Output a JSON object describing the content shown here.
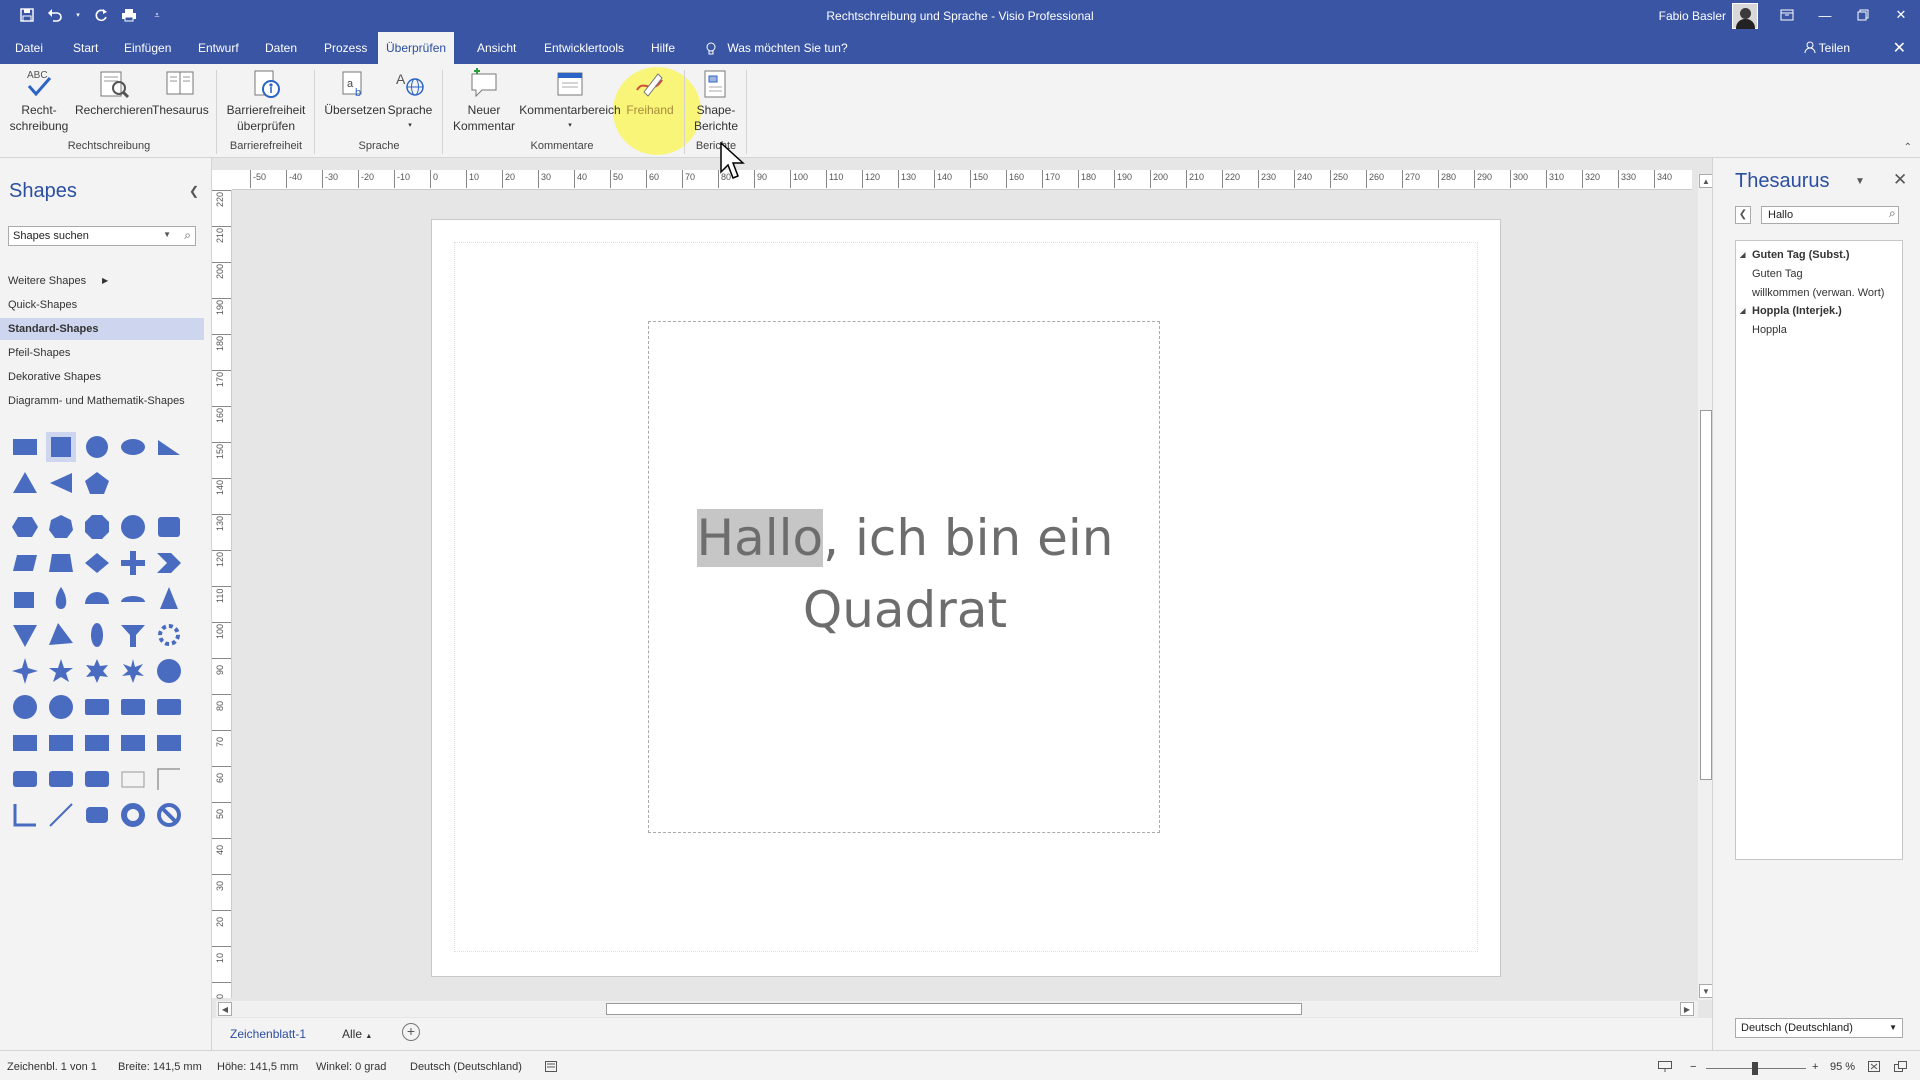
{
  "window": {
    "title": "Rechtschreibung und Sprache - Visio Professional",
    "user": "Fabio Basler",
    "qat": [
      "save-icon",
      "undo-icon",
      "redo-icon",
      "print-icon",
      "customize-icon"
    ]
  },
  "tabs": [
    "Datei",
    "Start",
    "Einfügen",
    "Entwurf",
    "Daten",
    "Prozess",
    "Überprüfen",
    "Ansicht",
    "Entwicklertools",
    "Hilfe"
  ],
  "active_tab": "Überprüfen",
  "tell_me": "Was möchten Sie tun?",
  "share": "Teilen",
  "ribbon": {
    "buttons": {
      "spelling": "Recht-\nschreibung",
      "research": "Recherchieren",
      "thesaurus": "Thesaurus",
      "accessibility": "Barrierefreiheit\nüberprüfen",
      "translate": "Übersetzen",
      "language": "Sprache",
      "new_comment": "Neuer\nKommentar",
      "comment_pane": "Kommentarbereich",
      "freehand": "Freihand",
      "shape_reports": "Shape-\nBerichte"
    },
    "groups": {
      "proofing": "Rechtschreibung",
      "accessibility": "Barrierefreiheit",
      "language": "Sprache",
      "comments": "Kommentare",
      "reports": "Berichte"
    }
  },
  "shapes_pane": {
    "title": "Shapes",
    "search_placeholder": "Shapes suchen",
    "stencils": [
      {
        "label": "Weitere Shapes",
        "selected": false
      },
      {
        "label": "Quick-Shapes",
        "selected": false
      },
      {
        "label": "Standard-Shapes",
        "selected": true
      },
      {
        "label": "Pfeil-Shapes",
        "selected": false
      },
      {
        "label": "Dekorative Shapes",
        "selected": false
      },
      {
        "label": "Diagramm- und Mathematik-Shapes",
        "selected": false
      }
    ]
  },
  "ruler": {
    "h_labels": [
      "-50",
      "-40",
      "-30",
      "-20",
      "-10",
      "0",
      "10",
      "20",
      "30",
      "40",
      "50",
      "60",
      "70",
      "80",
      "90",
      "100",
      "110",
      "120",
      "130",
      "140",
      "150",
      "160",
      "170",
      "180",
      "190",
      "200",
      "210",
      "220",
      "230",
      "240",
      "250",
      "260",
      "270",
      "280",
      "290",
      "300",
      "310",
      "320",
      "330",
      "340"
    ],
    "v_labels": [
      "220",
      "210",
      "200",
      "190",
      "180",
      "170",
      "160",
      "150",
      "140",
      "130",
      "120",
      "110",
      "100",
      "90",
      "80",
      "70",
      "60",
      "50",
      "40",
      "30",
      "20",
      "10",
      "0"
    ]
  },
  "canvas": {
    "highlight_word": "Hallo",
    "text_rest": ", ich bin ein",
    "text_line2": "Quadrat"
  },
  "sheets": {
    "tab": "Zeichenblatt-1",
    "all": "Alle"
  },
  "thesaurus": {
    "title": "Thesaurus",
    "search_value": "Hallo",
    "results": [
      {
        "text": "Guten Tag (Subst.)",
        "head": true
      },
      {
        "text": "Guten Tag",
        "head": false
      },
      {
        "text": "willkommen (verwan. Wort)",
        "head": false
      },
      {
        "text": "Hoppla (Interjek.)",
        "head": true
      },
      {
        "text": "Hoppla",
        "head": false
      }
    ],
    "language": "Deutsch (Deutschland)"
  },
  "status": {
    "page": "Zeichenbl. 1 von 1",
    "width": "Breite: 141,5 mm",
    "height": "Höhe: 141,5 mm",
    "angle": "Winkel: 0 grad",
    "language": "Deutsch (Deutschland)",
    "zoom": "95 %"
  },
  "colors": {
    "accent": "#3955a3",
    "shape_fill": "#4a6cc0"
  }
}
